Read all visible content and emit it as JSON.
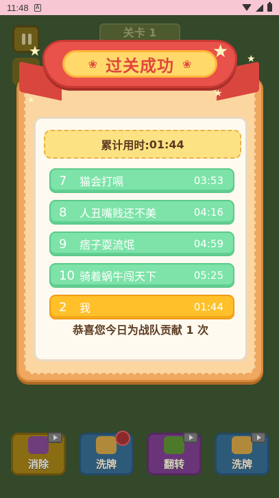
{
  "status_bar": {
    "time": "11:48"
  },
  "background": {
    "level_label": "关卡 1",
    "tools": [
      {
        "label": "消除",
        "icon": "eliminate-icon"
      },
      {
        "label": "洗牌",
        "icon": "shuffle-icon"
      },
      {
        "label": "翻转",
        "icon": "flip-icon"
      },
      {
        "label": "洗牌",
        "icon": "shuffle-icon"
      }
    ]
  },
  "dialog": {
    "title": "过关成功",
    "total_time_label": "累计用时:",
    "total_time_value": "01:44",
    "leaderboard": [
      {
        "rank": "7",
        "name": "猫会打嗝",
        "time": "03:53"
      },
      {
        "rank": "8",
        "name": "人丑嘴贱还不美",
        "time": "04:16"
      },
      {
        "rank": "9",
        "name": "痞子耍流氓",
        "time": "04:59"
      },
      {
        "rank": "10",
        "name": "骑着蜗牛闯天下",
        "time": "05:25"
      }
    ],
    "self_entry": {
      "rank": "2",
      "name": "我",
      "time": "01:44"
    },
    "congrats": "恭喜您今日为战队贡献 1 次"
  },
  "colors": {
    "ribbon": "#e8524a",
    "row_green": "#7de3a8",
    "row_gold": "#ffc02a",
    "text_brown": "#5b3b20"
  }
}
